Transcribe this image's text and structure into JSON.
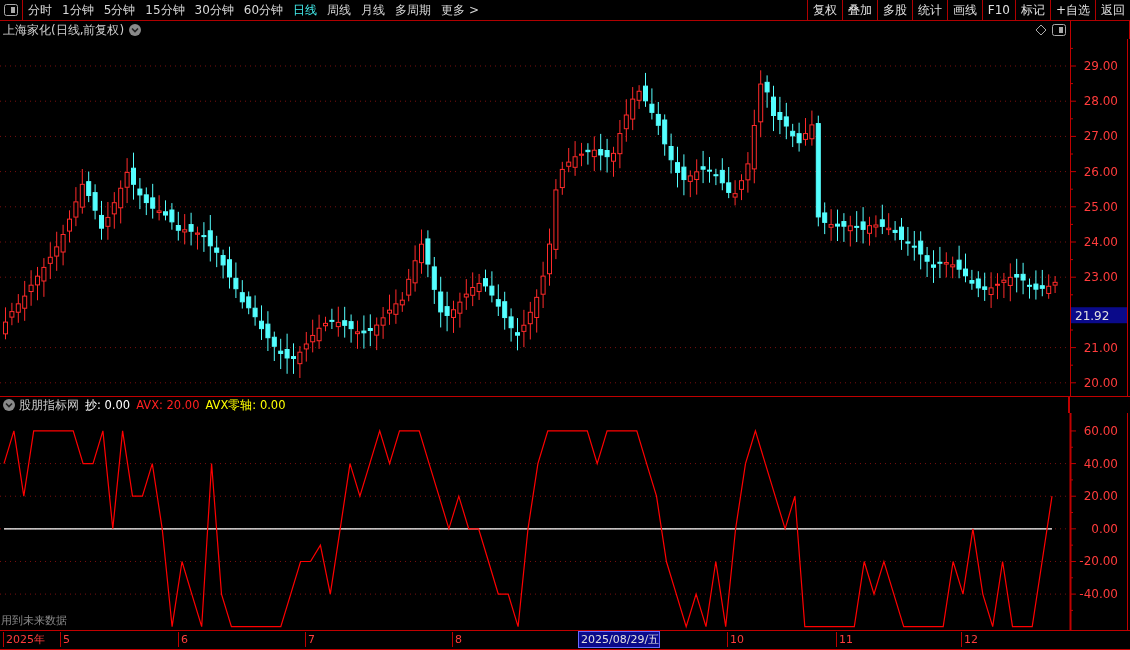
{
  "toolbar": {
    "periods": [
      {
        "label": "分时",
        "selected": false
      },
      {
        "label": "1分钟",
        "selected": false
      },
      {
        "label": "5分钟",
        "selected": false
      },
      {
        "label": "15分钟",
        "selected": false
      },
      {
        "label": "30分钟",
        "selected": false
      },
      {
        "label": "60分钟",
        "selected": false
      },
      {
        "label": "日线",
        "selected": true
      },
      {
        "label": "周线",
        "selected": false
      },
      {
        "label": "月线",
        "selected": false
      },
      {
        "label": "多周期",
        "selected": false
      },
      {
        "label": "更多 >",
        "selected": false
      }
    ],
    "buttons": [
      "复权",
      "叠加",
      "多股",
      "统计",
      "画线",
      "F10",
      "标记",
      "+自选",
      "返回"
    ]
  },
  "price_panel": {
    "title": "上海家化(日线,前复权)",
    "axis_labels": [
      "29.00",
      "28.00",
      "27.00",
      "26.00",
      "25.00",
      "24.00",
      "23.00",
      "21.00",
      "20.00"
    ],
    "current_price": "21.92"
  },
  "indicator_panel": {
    "indicator_name": "股朋指标网",
    "legend": [
      {
        "kind": "signal",
        "text": "抄: 0.00",
        "color": "#ffffff"
      },
      {
        "kind": "series",
        "text": ": 20.00",
        "color": "#ff2020"
      },
      {
        "kind": "series",
        "text": ": 0.00",
        "color": "#ffff00"
      }
    ],
    "note": "用到未来数据",
    "chart_data": {
      "type": "line",
      "grid": true,
      "ylim": [
        -62,
        71
      ],
      "yticks": [
        {
          "value": 60,
          "label": "60.00"
        },
        {
          "value": 40,
          "label": "40.00"
        },
        {
          "value": 20,
          "label": "20.00"
        },
        {
          "value": 0,
          "label": "0.00"
        },
        {
          "value": -20,
          "label": "-20.00"
        },
        {
          "value": -40,
          "label": "-40.00"
        }
      ],
      "series": [
        {
          "name": "AVX",
          "color": "#ff0000",
          "values": [
            40,
            60,
            20,
            60,
            60,
            60,
            60,
            60,
            40,
            40,
            60,
            0,
            60,
            20,
            20,
            40,
            0,
            -60,
            -20,
            -40,
            -60,
            40,
            -40,
            -60,
            -60,
            -60,
            -60,
            -60,
            -60,
            -40,
            -20,
            -20,
            -10,
            -40,
            0,
            40,
            20,
            40,
            60,
            40,
            60,
            60,
            60,
            40,
            20,
            0,
            20,
            0,
            0,
            -20,
            -40,
            -40,
            -60,
            0,
            40,
            60,
            60,
            60,
            60,
            60,
            40,
            60,
            60,
            60,
            60,
            40,
            20,
            -20,
            -40,
            -60,
            -40,
            -60,
            -20,
            -60,
            0,
            40,
            60,
            40,
            20,
            0,
            20,
            -60,
            -60,
            -60,
            -60,
            -60,
            -60,
            -20,
            -40,
            -20,
            -40,
            -60,
            -60,
            -60,
            -60,
            -60,
            -20,
            -40,
            0,
            -40,
            -60,
            -20,
            -60,
            -60,
            -60,
            -20,
            20
          ]
        },
        {
          "name": "AVX零轴",
          "color": "#ffffff",
          "values": [
            0,
            0,
            0,
            0,
            0,
            0,
            0,
            0,
            0,
            0,
            0,
            0,
            0,
            0,
            0,
            0,
            0,
            0,
            0,
            0,
            0,
            0,
            0,
            0,
            0,
            0,
            0,
            0,
            0,
            0,
            0,
            0,
            0,
            0,
            0,
            0,
            0,
            0,
            0,
            0,
            0,
            0,
            0,
            0,
            0,
            0,
            0,
            0,
            0,
            0,
            0,
            0,
            0,
            0,
            0,
            0,
            0,
            0,
            0,
            0,
            0,
            0,
            0,
            0,
            0,
            0,
            0,
            0,
            0,
            0,
            0,
            0,
            0,
            0,
            0,
            0,
            0,
            0,
            0,
            0,
            0,
            0,
            0,
            0,
            0,
            0,
            0,
            0,
            0,
            0,
            0,
            0,
            0,
            0,
            0,
            0,
            0,
            0,
            0,
            0,
            0,
            0,
            0,
            0,
            0,
            0,
            0
          ]
        }
      ]
    }
  },
  "date_axis": [
    {
      "label": "2025年",
      "selected": false
    },
    {
      "label": "5",
      "selected": false
    },
    {
      "label": "6",
      "selected": false
    },
    {
      "label": "7",
      "selected": false
    },
    {
      "label": "8",
      "selected": false
    },
    {
      "label": "2025/08/29/五",
      "selected": true
    },
    {
      "label": "10",
      "selected": false
    },
    {
      "label": "11",
      "selected": false
    },
    {
      "label": "12",
      "selected": false
    }
  ]
}
